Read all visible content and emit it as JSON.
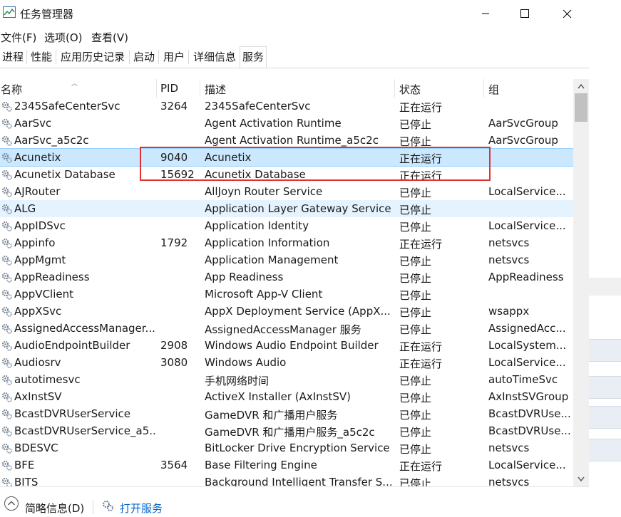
{
  "window": {
    "title": "任务管理器"
  },
  "menu": [
    "文件(F)",
    "选项(O)",
    "查看(V)"
  ],
  "tabs": [
    "进程",
    "性能",
    "应用历史记录",
    "启动",
    "用户",
    "详细信息",
    "服务"
  ],
  "active_tab": "服务",
  "columns": {
    "name": "名称",
    "pid": "PID",
    "desc": "描述",
    "status": "状态",
    "group": "组"
  },
  "rows": [
    {
      "name": "2345SafeCenterSvc",
      "pid": "3264",
      "desc": "2345SafeCenterSvc",
      "status": "正在运行",
      "group": ""
    },
    {
      "name": "AarSvc",
      "pid": "",
      "desc": "Agent Activation Runtime",
      "status": "已停止",
      "group": "AarSvcGroup"
    },
    {
      "name": "AarSvc_a5c2c",
      "pid": "",
      "desc": "Agent Activation Runtime_a5c2c",
      "status": "已停止",
      "group": "AarSvcGroup"
    },
    {
      "name": "Acunetix",
      "pid": "9040",
      "desc": "Acunetix",
      "status": "正在运行",
      "group": ""
    },
    {
      "name": "Acunetix Database",
      "pid": "15692",
      "desc": "Acunetix Database",
      "status": "正在运行",
      "group": ""
    },
    {
      "name": "AJRouter",
      "pid": "",
      "desc": "AllJoyn Router Service",
      "status": "已停止",
      "group": "LocalService..."
    },
    {
      "name": "ALG",
      "pid": "",
      "desc": "Application Layer Gateway Service",
      "status": "已停止",
      "group": ""
    },
    {
      "name": "AppIDSvc",
      "pid": "",
      "desc": "Application Identity",
      "status": "已停止",
      "group": "LocalService..."
    },
    {
      "name": "Appinfo",
      "pid": "1792",
      "desc": "Application Information",
      "status": "正在运行",
      "group": "netsvcs"
    },
    {
      "name": "AppMgmt",
      "pid": "",
      "desc": "Application Management",
      "status": "已停止",
      "group": "netsvcs"
    },
    {
      "name": "AppReadiness",
      "pid": "",
      "desc": "App Readiness",
      "status": "已停止",
      "group": "AppReadiness"
    },
    {
      "name": "AppVClient",
      "pid": "",
      "desc": "Microsoft App-V Client",
      "status": "已停止",
      "group": ""
    },
    {
      "name": "AppXSvc",
      "pid": "",
      "desc": "AppX Deployment Service (AppX...",
      "status": "已停止",
      "group": "wsappx"
    },
    {
      "name": "AssignedAccessManager...",
      "pid": "",
      "desc": "AssignedAccessManager 服务",
      "status": "已停止",
      "group": "AssignedAcc..."
    },
    {
      "name": "AudioEndpointBuilder",
      "pid": "2908",
      "desc": "Windows Audio Endpoint Builder",
      "status": "正在运行",
      "group": "LocalSystem..."
    },
    {
      "name": "Audiosrv",
      "pid": "3080",
      "desc": "Windows Audio",
      "status": "正在运行",
      "group": "LocalService..."
    },
    {
      "name": "autotimesvc",
      "pid": "",
      "desc": "手机网络时间",
      "status": "已停止",
      "group": "autoTimeSvc"
    },
    {
      "name": "AxInstSV",
      "pid": "",
      "desc": "ActiveX Installer (AxInstSV)",
      "status": "已停止",
      "group": "AxInstSVGroup"
    },
    {
      "name": "BcastDVRUserService",
      "pid": "",
      "desc": "GameDVR 和广播用户服务",
      "status": "已停止",
      "group": "BcastDVRUse..."
    },
    {
      "name": "BcastDVRUserService_a5...",
      "pid": "",
      "desc": "GameDVR 和广播用户服务_a5c2c",
      "status": "已停止",
      "group": "BcastDVRUse..."
    },
    {
      "name": "BDESVC",
      "pid": "",
      "desc": "BitLocker Drive Encryption Service",
      "status": "已停止",
      "group": "netsvcs"
    },
    {
      "name": "BFE",
      "pid": "3564",
      "desc": "Base Filtering Engine",
      "status": "正在运行",
      "group": "LocalService..."
    },
    {
      "name": "BITS",
      "pid": "",
      "desc": "Background Intelligent Transfer S...",
      "status": "已停止",
      "group": "netsvcs"
    }
  ],
  "footer": {
    "brief": "简略信息(D)",
    "open_services": "打开服务"
  },
  "colors": {
    "selected": "#cce8ff",
    "hover": "#e5f3ff",
    "highlight_box": "#e03232",
    "link": "#0066cc"
  }
}
